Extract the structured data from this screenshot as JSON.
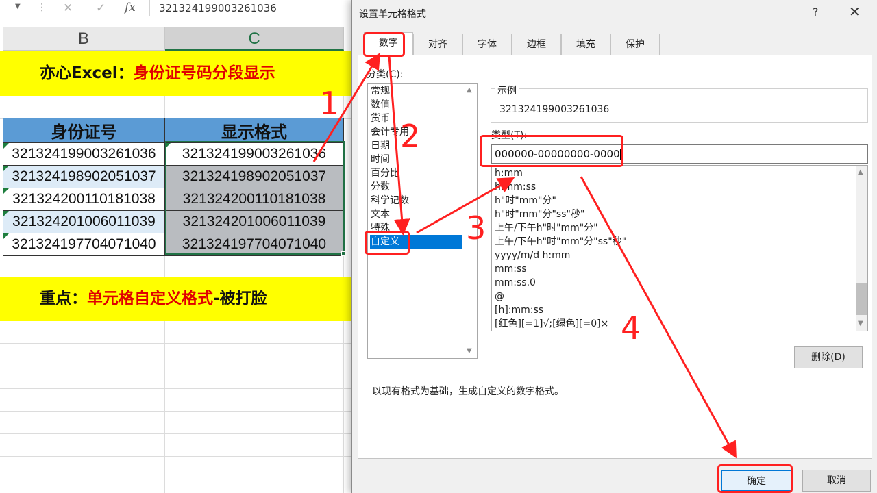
{
  "formula_bar": {
    "cancel_glyph": "✕",
    "enter_glyph": "✓",
    "fx_label": "fx",
    "value": "321324199003261036"
  },
  "columns": {
    "b": "B",
    "c": "C"
  },
  "banner_top": {
    "prefix": "亦心Excel：",
    "highlight": "身份证号码分段显示"
  },
  "table": {
    "headers": [
      "身份证号",
      "显示格式"
    ],
    "rows": [
      [
        "321324199003261036",
        "321324199003261036"
      ],
      [
        "321324198902051037",
        "321324198902051037"
      ],
      [
        "321324200110181038",
        "321324200110181038"
      ],
      [
        "321324201006011039",
        "321324201006011039"
      ],
      [
        "321324197704071040",
        "321324197704071040"
      ]
    ]
  },
  "banner_bottom": {
    "prefix": "重点：",
    "highlight": "单元格自定义格式",
    "suffix": "-被打脸"
  },
  "dialog": {
    "title": "设置单元格格式",
    "help": "?",
    "close": "✕",
    "tabs": [
      "数字",
      "对齐",
      "字体",
      "边框",
      "填充",
      "保护"
    ],
    "active_tab": "数字",
    "category_label": "分类(C):",
    "categories": [
      "常规",
      "数值",
      "货币",
      "会计专用",
      "日期",
      "时间",
      "百分比",
      "分数",
      "科学记数",
      "文本",
      "特殊",
      "自定义"
    ],
    "selected_category": "自定义",
    "sample_label": "示例",
    "sample_value": "321324199003261036",
    "type_label": "类型(T):",
    "type_value": "000000-00000000-0000",
    "format_list": [
      "h:mm",
      "h:mm:ss",
      "h\"时\"mm\"分\"",
      "h\"时\"mm\"分\"ss\"秒\"",
      "上午/下午h\"时\"mm\"分\"",
      "上午/下午h\"时\"mm\"分\"ss\"秒\"",
      "yyyy/m/d h:mm",
      "mm:ss",
      "mm:ss.0",
      "@",
      "[h]:mm:ss",
      "[红色][=1]√;[绿色][=0]×"
    ],
    "delete_button": "删除(D)",
    "hint": "以现有格式为基础，生成自定义的数字格式。",
    "ok_button": "确定",
    "cancel_button": "取消"
  },
  "annotations": {
    "color": "#ff2020",
    "step_numbers": [
      "1",
      "2",
      "3",
      "4"
    ]
  }
}
